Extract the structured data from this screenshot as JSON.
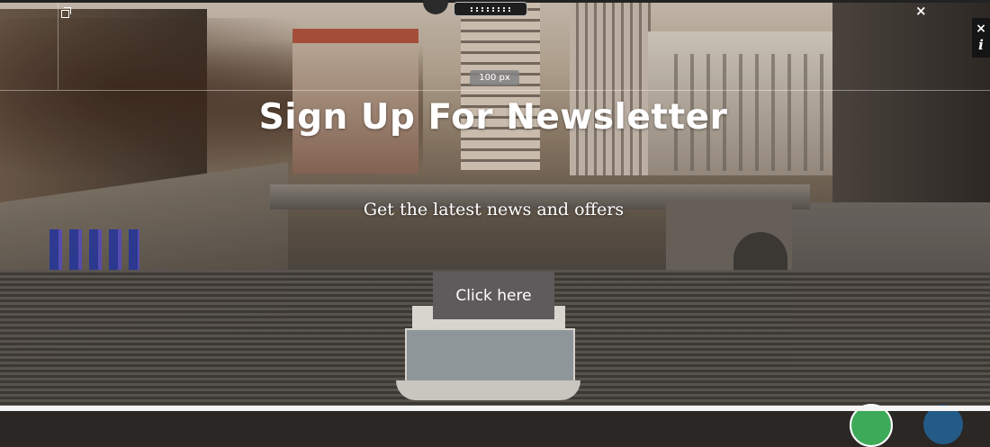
{
  "hero": {
    "title": "Sign Up For Newsletter",
    "subtitle": "Get the latest news and offers",
    "cta_label": "Click here"
  },
  "editor": {
    "spacing_badge": "100 px",
    "close_glyph": "×",
    "info_glyph": "i"
  },
  "icons": [
    "copy-icon",
    "drag-handle-icon",
    "close-icon",
    "info-icon"
  ],
  "colors": {
    "cta_background": "#5f5a5c",
    "text": "#ffffff",
    "fab_green": "#3daa5a",
    "fab_blue": "#245a86"
  }
}
